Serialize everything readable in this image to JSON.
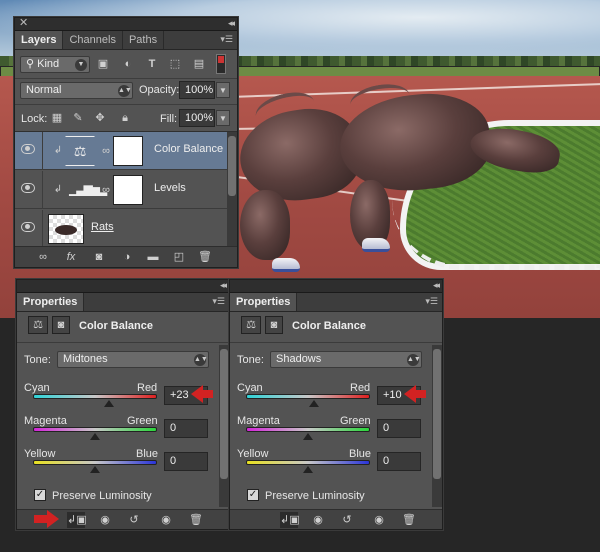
{
  "layers_panel": {
    "tabs": [
      "Layers",
      "Channels",
      "Paths"
    ],
    "filter_kind": "Kind",
    "blend_mode": "Normal",
    "opacity_label": "Opacity:",
    "opacity_value": "100%",
    "lock_label": "Lock:",
    "fill_label": "Fill:",
    "fill_value": "100%",
    "layers": [
      {
        "name": "Color Balance",
        "selected": true
      },
      {
        "name": "Levels",
        "selected": false
      },
      {
        "name": "Rats",
        "selected": false
      }
    ]
  },
  "props_left": {
    "tab": "Properties",
    "heading": "Color Balance",
    "tone_label": "Tone:",
    "tone_value": "Midtones",
    "cyan": "Cyan",
    "red": "Red",
    "cyan_red_value": "+23",
    "cyan_red_fraction": 0.615,
    "magenta": "Magenta",
    "green": "Green",
    "magenta_green_value": "0",
    "magenta_green_fraction": 0.5,
    "yellow": "Yellow",
    "blue": "Blue",
    "yellow_blue_value": "0",
    "yellow_blue_fraction": 0.5,
    "preserve_label": "Preserve Luminosity"
  },
  "props_right": {
    "tab": "Properties",
    "heading": "Color Balance",
    "tone_label": "Tone:",
    "tone_value": "Shadows",
    "cyan": "Cyan",
    "red": "Red",
    "cyan_red_value": "+10",
    "cyan_red_fraction": 0.55,
    "magenta": "Magenta",
    "green": "Green",
    "magenta_green_value": "0",
    "magenta_green_fraction": 0.5,
    "yellow": "Yellow",
    "blue": "Blue",
    "yellow_blue_value": "0",
    "yellow_blue_fraction": 0.5,
    "preserve_label": "Preserve Luminosity"
  },
  "colors": {
    "selected_row": "#667a94",
    "annotation_arrow": "#d22222"
  }
}
